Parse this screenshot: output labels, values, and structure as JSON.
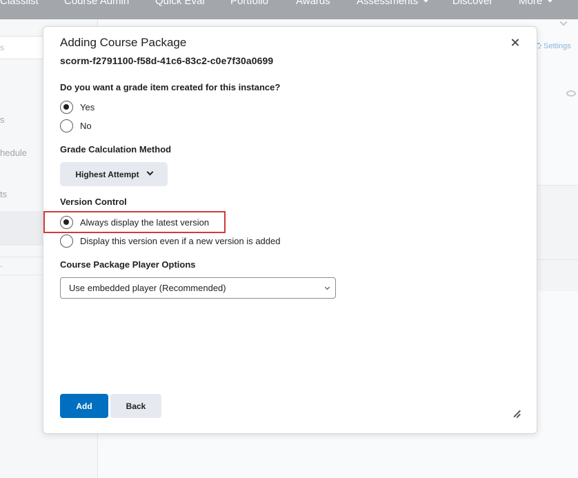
{
  "topnav": {
    "items": [
      "Classlist",
      "Course Admin",
      "Quick Eval",
      "Portfolio",
      "Awards",
      "Assessments",
      "Discover",
      "More"
    ]
  },
  "background": {
    "search_hint": "s",
    "sidebar_fragments": [
      "s",
      "hedule",
      "ts",
      "."
    ],
    "settings_label": "Settings"
  },
  "modal": {
    "title": "Adding Course Package",
    "subtitle": "scorm-f2791100-f58d-41c6-83c2-c0e7f30a0699",
    "grade_question": "Do you want a grade item created for this instance?",
    "grade_options": [
      {
        "label": "Yes",
        "checked": true
      },
      {
        "label": "No",
        "checked": false
      }
    ],
    "grade_calc_label": "Grade Calculation Method",
    "grade_calc_value": "Highest Attempt",
    "version_label": "Version Control",
    "version_options": [
      {
        "label": "Always display the latest version",
        "checked": true
      },
      {
        "label": "Display this version even if a new version is added",
        "checked": false
      }
    ],
    "player_label": "Course Package Player Options",
    "player_value": "Use embedded player (Recommended)",
    "add_label": "Add",
    "back_label": "Back"
  },
  "colors": {
    "primary": "#006fbf",
    "highlight": "#d03a3a",
    "nav_bg": "#a3a6aa"
  }
}
